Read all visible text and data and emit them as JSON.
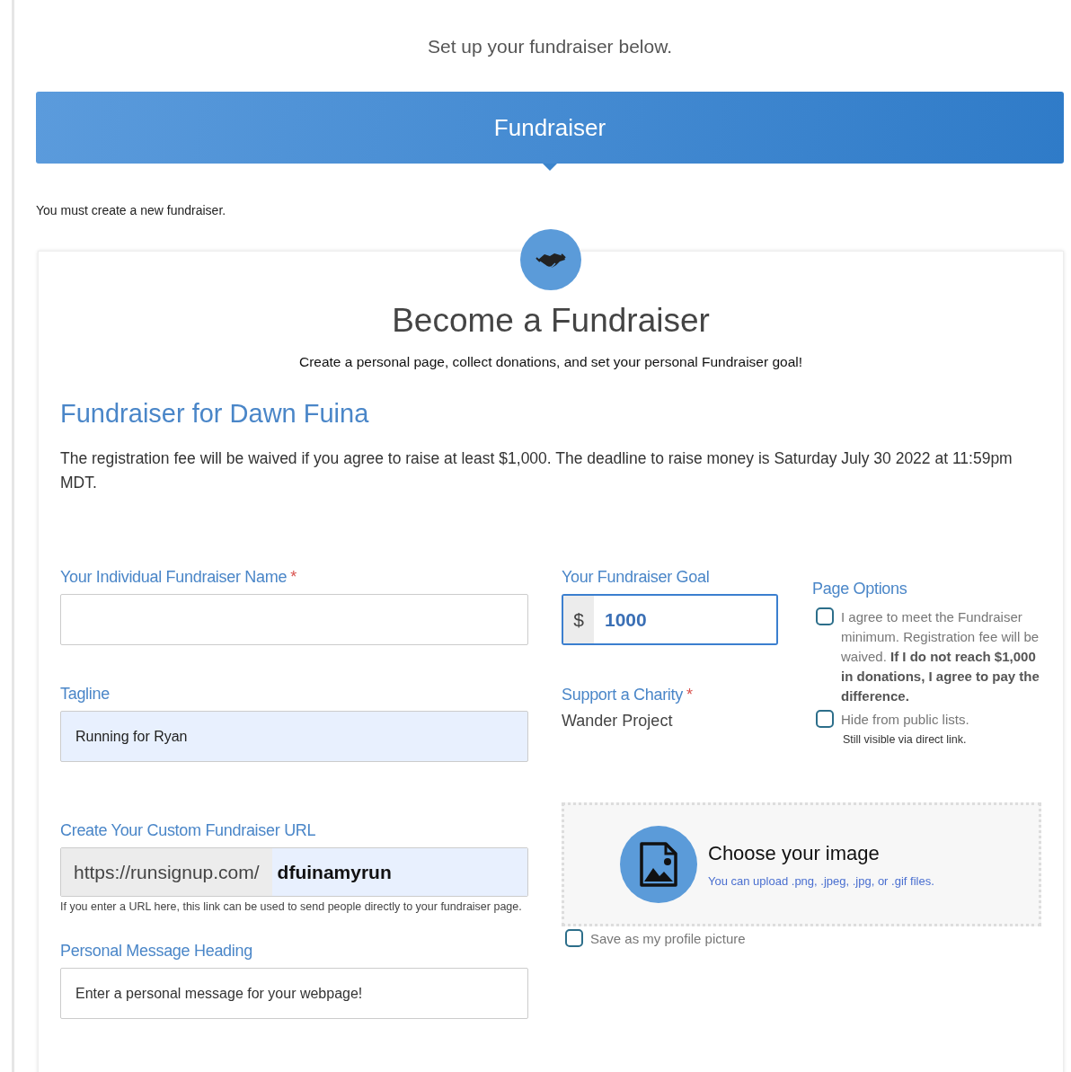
{
  "intro": "Set up your fundraiser below.",
  "banner": {
    "title": "Fundraiser"
  },
  "notice": "You must create a new fundraiser.",
  "card": {
    "title": "Become a Fundraiser",
    "subtitle": "Create a personal page, collect donations, and set your personal Fundraiser goal!",
    "heading": "Fundraiser for Dawn Fuina",
    "description": "The registration fee will be waived if you agree to raise at least $1,000. The deadline to raise money is Saturday July 30 2022 at 11:59pm MDT."
  },
  "left_fields": [
    {
      "kind": "text",
      "label": "Your Individual Fundraiser Name",
      "required_mark": "*",
      "autofilled": false
    },
    {
      "kind": "text",
      "label": "Tagline",
      "value": "Running for Ryan",
      "autofilled": true
    },
    {
      "kind": "url",
      "label": "Create Your Custom Fundraiser URL",
      "prefix": "https://runsignup.com/",
      "value": "dfuinamyrun",
      "autofilled": true,
      "help": "If you enter a URL here, this link can be used to send people directly to your fundraiser page."
    },
    {
      "kind": "text",
      "label": "Personal Message Heading",
      "placeholder": "Enter a personal message for your webpage!",
      "autofilled": false
    }
  ],
  "goal": {
    "label": "Your Fundraiser Goal",
    "prefix": "$",
    "value": "1000",
    "focused": true
  },
  "charity": {
    "label": "Support a Charity",
    "required_mark": "*",
    "value": "Wander Project"
  },
  "page_options": {
    "label": "Page Options",
    "options": [
      {
        "text": "I agree to meet the Fundraiser minimum. Registration fee will be waived. **If I do not reach $1,000 in donations, I agree to pay the difference.**",
        "checked": false
      },
      {
        "text": "Hide from public lists.",
        "checked": false,
        "note": "Still visible via direct link."
      }
    ]
  },
  "image_upload": {
    "title": "Choose your image",
    "hint": "You can upload .png, .jpeg, .jpg, or .gif files.",
    "save_profile": {
      "label": "Save as my profile picture",
      "checked": false
    }
  }
}
